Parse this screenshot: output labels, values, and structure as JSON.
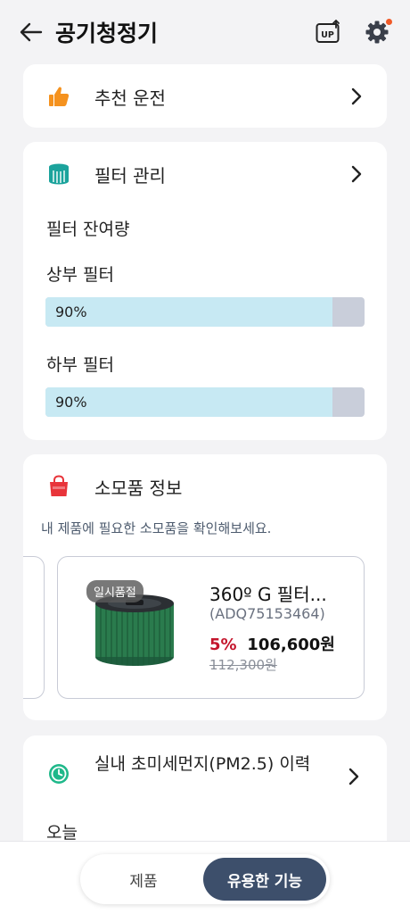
{
  "header": {
    "title": "공기청정기",
    "update_badge": "UP"
  },
  "recommend": {
    "label": "추천 운전"
  },
  "filter": {
    "label": "필터 관리",
    "remaining_label": "필터 잔여량",
    "top": {
      "label": "상부 필터",
      "value_text": "90%",
      "percent": 90
    },
    "bottom": {
      "label": "하부 필터",
      "value_text": "90%",
      "percent": 90
    }
  },
  "consumables": {
    "label": "소모품 정보",
    "subtitle": "내 제품에 필요한 소모품을 확인해보세요.",
    "product": {
      "badge": "일시품절",
      "name": "360º G 필터...",
      "code": "(ADQ75153464)",
      "discount": "5%",
      "price": "106,600원",
      "original_price": "112,300원"
    }
  },
  "pm": {
    "label": "실내 초미세먼지(PM2.5) 이력",
    "today": "오늘"
  },
  "tabs": {
    "product": "제품",
    "useful": "유용한 기능",
    "active": "useful"
  },
  "colors": {
    "accent_orange": "#f5921e",
    "filter_teal": "#1ba39c",
    "bag_red": "#e8343a",
    "history_green": "#1fb88a",
    "discount_red": "#c4152c",
    "active_tab": "#3d4f6b",
    "bar_fill": "#c7e9f3",
    "bar_track": "#c9ceda"
  }
}
